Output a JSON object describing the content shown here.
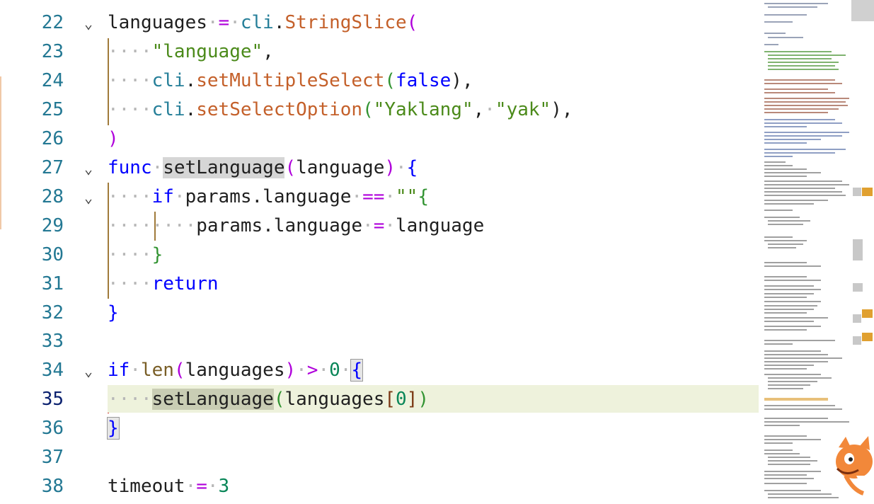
{
  "editor": {
    "lines": [
      {
        "num": "22",
        "fold": true
      },
      {
        "num": "23",
        "fold": false
      },
      {
        "num": "24",
        "fold": false
      },
      {
        "num": "25",
        "fold": false
      },
      {
        "num": "26",
        "fold": false
      },
      {
        "num": "27",
        "fold": true
      },
      {
        "num": "28",
        "fold": true
      },
      {
        "num": "29",
        "fold": false
      },
      {
        "num": "30",
        "fold": false
      },
      {
        "num": "31",
        "fold": false
      },
      {
        "num": "32",
        "fold": false
      },
      {
        "num": "33",
        "fold": false
      },
      {
        "num": "34",
        "fold": true
      },
      {
        "num": "35",
        "fold": false,
        "active": true
      },
      {
        "num": "36",
        "fold": false
      },
      {
        "num": "37",
        "fold": false
      },
      {
        "num": "38",
        "fold": false
      }
    ],
    "code": {
      "l22": {
        "a": "languages",
        "b": "=",
        "c": "cli",
        "d": ".",
        "e": "StringSlice",
        "f": "("
      },
      "l23": {
        "a": "\"language\"",
        "b": ","
      },
      "l24": {
        "a": "cli",
        "b": ".",
        "c": "setMultipleSelect",
        "d": "(",
        "e": "false",
        "f": "),"
      },
      "l25": {
        "a": "cli",
        "b": ".",
        "c": "setSelectOption",
        "d": "(",
        "e": "\"Yaklang\"",
        "f": ",",
        "g": "\"yak\"",
        "h": "),"
      },
      "l26": {
        "a": ")"
      },
      "l27": {
        "a": "func",
        "b": "setLanguage",
        "c": "(",
        "d": "language",
        "e": ")",
        "f": "{"
      },
      "l28": {
        "a": "if",
        "b": "params.language",
        "c": "==",
        "d": "\"\"",
        "e": "{"
      },
      "l29": {
        "a": "params.language",
        "b": "=",
        "c": "language"
      },
      "l30": {
        "a": "}"
      },
      "l31": {
        "a": "return"
      },
      "l32": {
        "a": "}"
      },
      "l34": {
        "a": "if",
        "b": "len",
        "c": "(",
        "d": "languages",
        "e": ")",
        "f": ">",
        "g": "0",
        "h": "{"
      },
      "l35": {
        "a": "setLanguage",
        "b": "(",
        "c": "languages",
        "d": "[",
        "e": "0",
        "f": "]",
        "g": ")"
      },
      "l36": {
        "a": "}"
      },
      "l38": {
        "a": "timeout",
        "b": "=",
        "c": "3"
      }
    },
    "whitespace_dot": "·",
    "fold_chevron": "chevron-down-icon"
  },
  "minimap": {
    "accent_marks": "#e8a33a"
  },
  "colors": {
    "line_number": "#237893",
    "keyword": "#0000ff",
    "string": "#4b8a1a",
    "function": "#c4602a",
    "current_line_bg": "#eef2dc"
  }
}
